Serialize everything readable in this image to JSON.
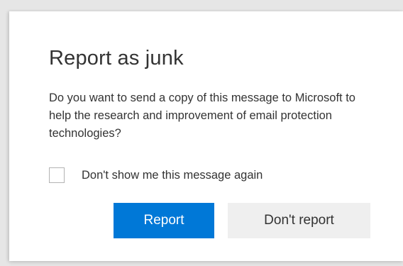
{
  "dialog": {
    "title": "Report as junk",
    "message": "Do you want to send a copy of this message to Microsoft to help the research and improvement of email protection technologies?",
    "checkbox": {
      "label": "Don't show me this message again",
      "checked": false
    },
    "buttons": {
      "report_label": "Report",
      "dont_report_label": "Don't report"
    }
  },
  "colors": {
    "primary": "#0078d7",
    "secondary_bg": "#efefef",
    "text": "#333333"
  }
}
